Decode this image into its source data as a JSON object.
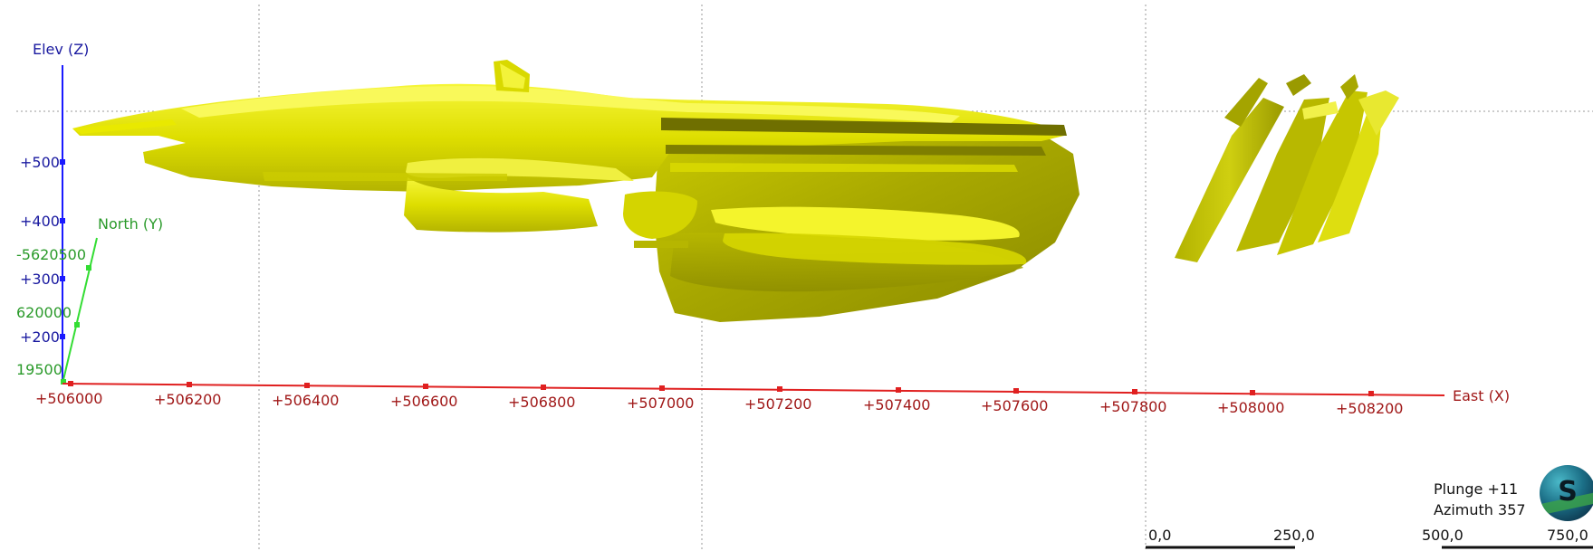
{
  "view": {
    "plunge_text": "Plunge +11",
    "azimuth_text": "Azimuth 357"
  },
  "axes": {
    "z": {
      "title": "Elev (Z)",
      "ticks": [
        "+500",
        "+400",
        "+300",
        "+200"
      ],
      "color": "#1a1aa0"
    },
    "y": {
      "title": "North (Y)",
      "ticks": [
        "-5620500",
        "620000",
        "19500"
      ],
      "color": "#2a9a2a"
    },
    "x": {
      "title": "East (X)",
      "ticks": [
        "+506000",
        "+506200",
        "+506400",
        "+506600",
        "+506800",
        "+507000",
        "+507200",
        "+507400",
        "+507600",
        "+507800",
        "+508000",
        "+508200"
      ],
      "color": "#a01818"
    }
  },
  "scale_bar": {
    "labels": [
      "0,0",
      "250,0",
      "500,0",
      "750,0"
    ]
  },
  "logo": {
    "letter": "S"
  },
  "colors": {
    "solid_main": "#e6e600",
    "solid_dark": "#8e8e00",
    "solid_light": "#f8f84a",
    "grid": "#9a9a9a"
  }
}
